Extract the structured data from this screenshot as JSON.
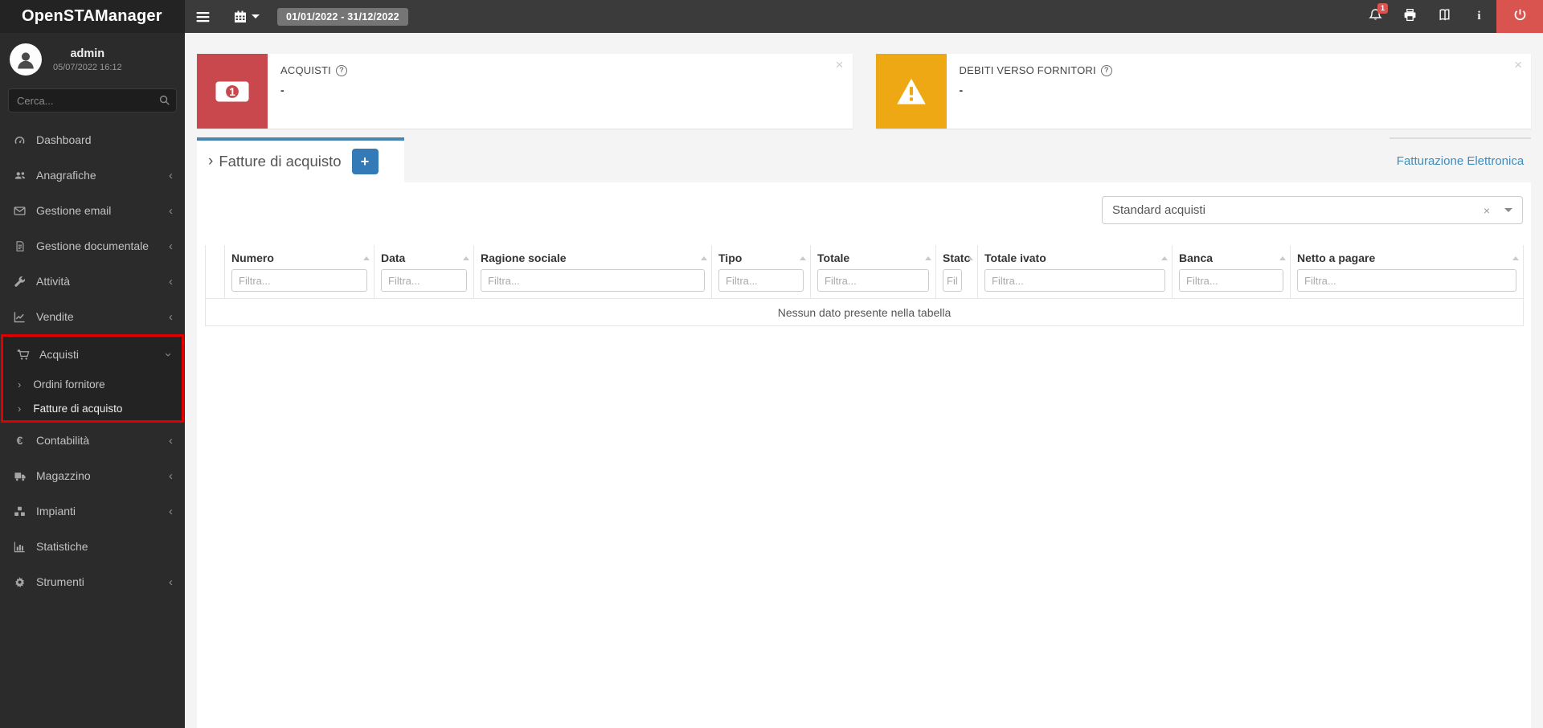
{
  "app": {
    "name": "OpenSTAManager"
  },
  "topbar": {
    "date_range": "01/01/2022 - 31/12/2022",
    "notification_count": "1"
  },
  "user": {
    "name": "admin",
    "login_datetime": "05/07/2022 16:12"
  },
  "search": {
    "placeholder": "Cerca..."
  },
  "menu": {
    "items": [
      {
        "label": "Dashboard"
      },
      {
        "label": "Anagrafiche"
      },
      {
        "label": "Gestione email"
      },
      {
        "label": "Gestione documentale"
      },
      {
        "label": "Attività"
      },
      {
        "label": "Vendite"
      },
      {
        "label": "Acquisti",
        "expanded": true,
        "children": [
          {
            "label": "Ordini fornitore"
          },
          {
            "label": "Fatture di acquisto"
          }
        ]
      },
      {
        "label": "Contabilità"
      },
      {
        "label": "Magazzino"
      },
      {
        "label": "Impianti"
      },
      {
        "label": "Statistiche"
      },
      {
        "label": "Strumenti"
      }
    ]
  },
  "infoboxes": [
    {
      "title": "ACQUISTI",
      "value": "-"
    },
    {
      "title": "DEBITI VERSO FORNITORI",
      "value": "-"
    }
  ],
  "tabs": {
    "active_label": "Fatture di acquisto",
    "add_button": "+",
    "right_tab_label": "Fatturazione Elettronica"
  },
  "toolbar": {
    "filter_select_value": "Standard acquisti"
  },
  "table": {
    "filter_placeholder": "Filtra...",
    "empty_message": "Nessun dato presente nella tabella",
    "columns": [
      {
        "label": "Numero"
      },
      {
        "label": "Data"
      },
      {
        "label": "Ragione sociale"
      },
      {
        "label": "Tipo"
      },
      {
        "label": "Totale"
      },
      {
        "label": "Stato"
      },
      {
        "label": "Totale ivato"
      },
      {
        "label": "Banca"
      },
      {
        "label": "Netto a pagare"
      }
    ]
  },
  "glyphs": {
    "chevron_collapsed": "‹",
    "chevron_expanded": "‹",
    "submenu_arrow": "›",
    "tab_arrow": "›",
    "close": "×",
    "clear": "×",
    "help": "?",
    "info": "i",
    "euro": "€"
  },
  "colors": {
    "accent_blue": "#337ab7",
    "link_blue": "#3c8dbc",
    "active_tab_blue": "#4786b2",
    "danger_red": "#c9484e",
    "warning_yellow": "#eda813",
    "highlight_annotation_red": "#e00000",
    "power_red": "#d9534f",
    "topbar_gray": "#3b3b3b",
    "sidebar_gray": "#2b2b2b"
  }
}
